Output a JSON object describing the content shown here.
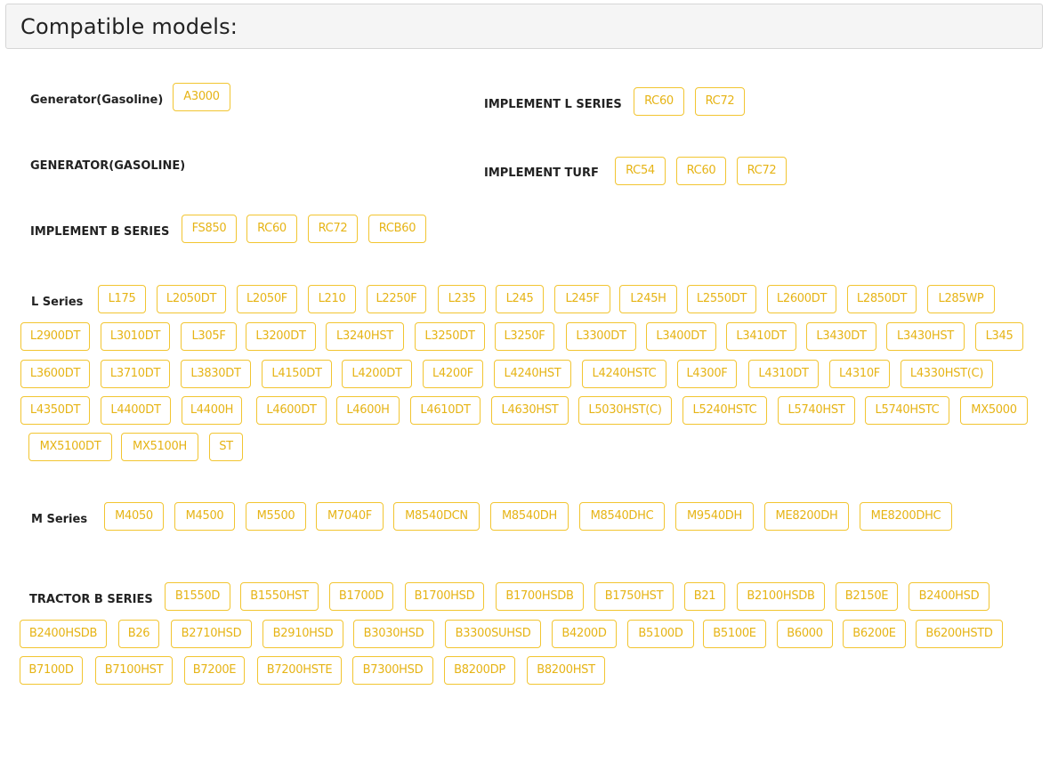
{
  "heading": "Compatible models:",
  "groups": [
    {
      "label": "Generator(Gasoline)",
      "models": [
        "A3000"
      ]
    },
    {
      "label": "IMPLEMENT L SERIES",
      "models": [
        "RC60",
        "RC72"
      ]
    },
    {
      "label": "GENERATOR(GASOLINE)",
      "models": []
    },
    {
      "label": "IMPLEMENT TURF",
      "models": [
        "RC54",
        "RC60",
        "RC72"
      ]
    },
    {
      "label": "IMPLEMENT B SERIES",
      "models": [
        "FS850",
        "RC60",
        "RC72",
        "RCB60"
      ]
    },
    {
      "label": "L Series",
      "models": [
        "L175",
        "L2050DT",
        "L2050F",
        "L210",
        "L2250F",
        "L235",
        "L245",
        "L245F",
        "L245H",
        "L2550DT",
        "L2600DT",
        "L2850DT",
        "L285WP",
        "L2900DT",
        "L3010DT",
        "L305F",
        "L3200DT",
        "L3240HST",
        "L3250DT",
        "L3250F",
        "L3300DT",
        "L3400DT",
        "L3410DT",
        "L3430DT",
        "L3430HST",
        "L345",
        "L3600DT",
        "L3710DT",
        "L3830DT",
        "L4150DT",
        "L4200DT",
        "L4200F",
        "L4240HST",
        "L4240HSTC",
        "L4300F",
        "L4310DT",
        "L4310F",
        "L4330HST(C)",
        "L4350DT",
        "L4400DT",
        "L4400H",
        "L4600DT",
        "L4600H",
        "L4610DT",
        "L4630HST",
        "L5030HST(C)",
        "L5240HSTC",
        "L5740HST",
        "L5740HSTC",
        "MX5000",
        "MX5100DT",
        "MX5100H",
        "ST"
      ]
    },
    {
      "label": "M Series",
      "models": [
        "M4050",
        "M4500",
        "M5500",
        "M7040F",
        "M8540DCN",
        "M8540DH",
        "M8540DHC",
        "M9540DH",
        "ME8200DH",
        "ME8200DHC"
      ]
    },
    {
      "label": "TRACTOR B SERIES",
      "models": [
        "B1550D",
        "B1550HST",
        "B1700D",
        "B1700HSD",
        "B1700HSDB",
        "B1750HST",
        "B21",
        "B2100HSDB",
        "B2150E",
        "B2400HSD",
        "B2400HSDB",
        "B26",
        "B2710HSD",
        "B2910HSD",
        "B3030HSD",
        "B3300SUHSD",
        "B4200D",
        "B5100D",
        "B5100E",
        "B6000",
        "B6200E",
        "B6200HSTD",
        "B7100D",
        "B7100HST",
        "B7200E",
        "B7200HSTE",
        "B7300HSD",
        "B8200DP",
        "B8200HST"
      ]
    }
  ]
}
